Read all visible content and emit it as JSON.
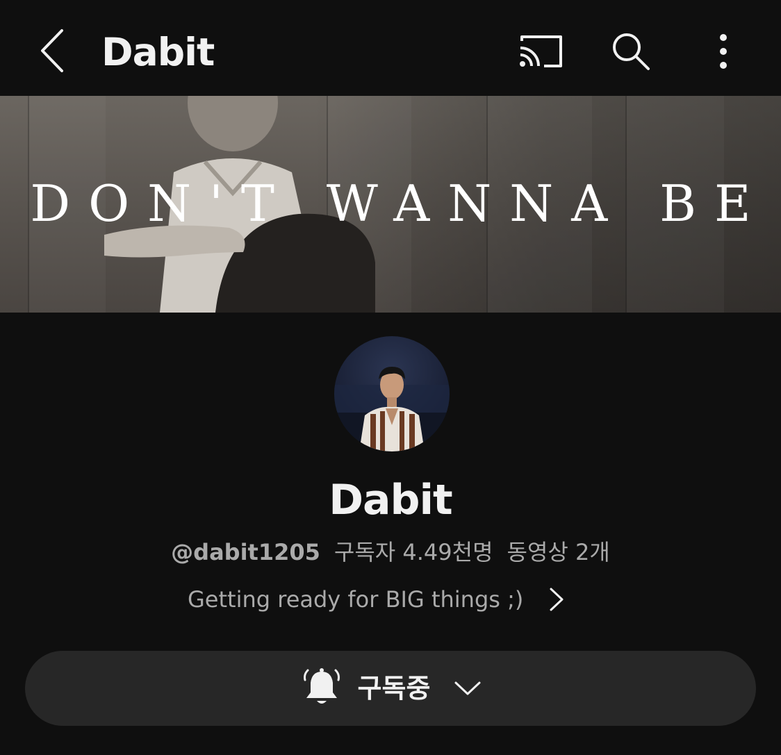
{
  "header": {
    "title": "Dabit",
    "back_icon": "chevron-left-icon",
    "cast_icon": "cast-icon",
    "search_icon": "search-icon",
    "more_icon": "more-vertical-icon"
  },
  "banner": {
    "text": "DON'T WANNA BE"
  },
  "channel": {
    "name": "Dabit",
    "handle": "@dabit1205",
    "subscribers": "구독자 4.49천명",
    "videos": "동영상 2개",
    "description": "Getting ready for BIG things ;)"
  },
  "subscribe_button": {
    "label": "구독중",
    "bell_icon": "bell-ringing-icon",
    "chevron_icon": "chevron-down-icon"
  },
  "colors": {
    "background": "#0f0f0f",
    "button_bg": "#272727",
    "text_primary": "#f1f1f1",
    "text_secondary": "#aaaaaa"
  }
}
